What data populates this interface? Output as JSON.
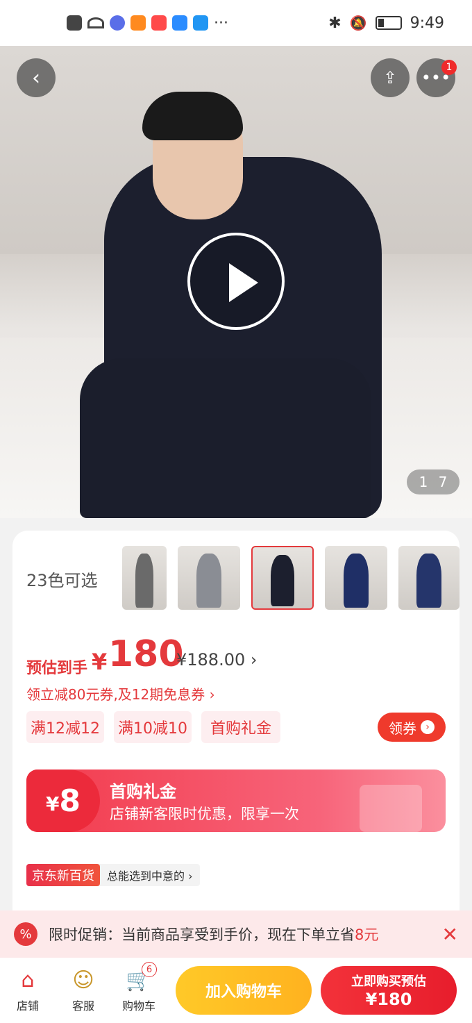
{
  "status_bar": {
    "time": "9:49",
    "more_dots": "···"
  },
  "hero": {
    "pager_current": "1",
    "pager_total": "7"
  },
  "top_actions": {
    "more_badge": "1"
  },
  "colors": {
    "label": "23色可选"
  },
  "price": {
    "estimate_label": "预估到手",
    "currency": "¥",
    "amount": "180",
    "original": "¥188.00",
    "original_arrow": "›",
    "coupon_line": "领立减80元券,及12期免息券 ›"
  },
  "tags": [
    "满12减12",
    "满10减10",
    "首购礼金"
  ],
  "get_coupon_label": "领券",
  "gift": {
    "currency": "¥",
    "amount": "8",
    "title": "首购礼金",
    "subtitle": "店铺新客限时优惠，限享一次"
  },
  "store": {
    "brand": "京东新百货",
    "slogan": "总能选到中意的 ›"
  },
  "promo": {
    "icon_glyph": "%",
    "text": "限时促销：当前商品享受到手价，现在下单立省",
    "amount": "8元",
    "close": "✕"
  },
  "bottom_nav": {
    "store_label": "店铺",
    "service_label": "客服",
    "cart_label": "购物车",
    "cart_count": "6"
  },
  "actions": {
    "add_to_cart": "加入购物车",
    "buy_now_line1": "立即购买预估",
    "buy_now_line2": "¥180"
  },
  "colors_theme": {
    "accent": "#e4393c",
    "cart_yellow": "#ffc928",
    "buy_red": "#ef2b2b"
  }
}
